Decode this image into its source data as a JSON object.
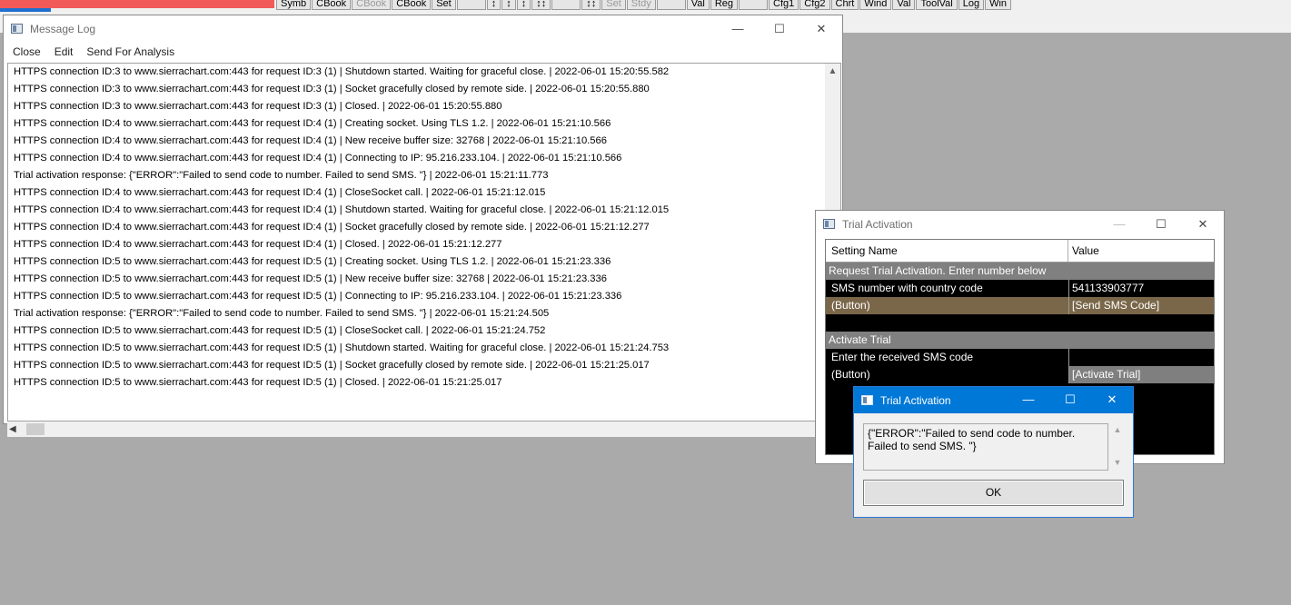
{
  "toolbar": {
    "buttons": [
      "Symb",
      "CBook",
      "CBook",
      "CBook",
      "Set",
      "",
      "↕",
      "↕",
      "↕",
      "↕↕",
      "",
      "↕↕",
      "Set",
      "Stdy",
      "",
      "Val",
      "Reg",
      "",
      "Cfg1",
      "Cfg2",
      "Chrt",
      "Wind",
      "Val",
      "ToolVal",
      "Log",
      "Win"
    ]
  },
  "message_log": {
    "title": "Message Log",
    "menu": [
      "Close",
      "Edit",
      "Send For Analysis"
    ],
    "lines": [
      "HTTPS connection ID:3 to www.sierrachart.com:443 for request ID:3 (1) | Shutdown started.  Waiting for graceful close. | 2022-06-01  15:20:55.582",
      "HTTPS connection ID:3 to www.sierrachart.com:443 for request ID:3 (1) | Socket gracefully closed by remote side. | 2022-06-01  15:20:55.880",
      "HTTPS connection ID:3 to www.sierrachart.com:443 for request ID:3 (1) | Closed. | 2022-06-01  15:20:55.880",
      "HTTPS connection ID:4 to www.sierrachart.com:443 for request ID:4 (1) | Creating socket.  Using TLS 1.2. | 2022-06-01  15:21:10.566",
      "HTTPS connection ID:4 to www.sierrachart.com:443 for request ID:4 (1) | New receive buffer size: 32768 | 2022-06-01  15:21:10.566",
      "HTTPS connection ID:4 to www.sierrachart.com:443 for request ID:4 (1) | Connecting to IP: 95.216.233.104. | 2022-06-01  15:21:10.566",
      "Trial activation response: {\"ERROR\":\"Failed to send code to number.  Failed to send SMS. \"} | 2022-06-01  15:21:11.773",
      "HTTPS connection ID:4 to www.sierrachart.com:443 for request ID:4 (1) | CloseSocket call. | 2022-06-01  15:21:12.015",
      "HTTPS connection ID:4 to www.sierrachart.com:443 for request ID:4 (1) | Shutdown started.  Waiting for graceful close. | 2022-06-01  15:21:12.015",
      "HTTPS connection ID:4 to www.sierrachart.com:443 for request ID:4 (1) | Socket gracefully closed by remote side. | 2022-06-01  15:21:12.277",
      "HTTPS connection ID:4 to www.sierrachart.com:443 for request ID:4 (1) | Closed. | 2022-06-01  15:21:12.277",
      "HTTPS connection ID:5 to www.sierrachart.com:443 for request ID:5 (1) | Creating socket.  Using TLS 1.2. | 2022-06-01  15:21:23.336",
      "HTTPS connection ID:5 to www.sierrachart.com:443 for request ID:5 (1) | New receive buffer size: 32768 | 2022-06-01  15:21:23.336",
      "HTTPS connection ID:5 to www.sierrachart.com:443 for request ID:5 (1) | Connecting to IP: 95.216.233.104. | 2022-06-01  15:21:23.336",
      "Trial activation response: {\"ERROR\":\"Failed to send code to number.  Failed to send SMS. \"} | 2022-06-01  15:21:24.505",
      "HTTPS connection ID:5 to www.sierrachart.com:443 for request ID:5 (1) | CloseSocket call. | 2022-06-01  15:21:24.752",
      "HTTPS connection ID:5 to www.sierrachart.com:443 for request ID:5 (1) | Shutdown started.  Waiting for graceful close. | 2022-06-01  15:21:24.753",
      "HTTPS connection ID:5 to www.sierrachart.com:443 for request ID:5 (1) | Socket gracefully closed by remote side. | 2022-06-01  15:21:25.017",
      "HTTPS connection ID:5 to www.sierrachart.com:443 for request ID:5 (1) | Closed. | 2022-06-01  15:21:25.017"
    ]
  },
  "trial_settings": {
    "title": "Trial Activation",
    "col_setting": "Setting Name",
    "col_value": "Value",
    "section1": "Request Trial Activation. Enter number below",
    "sms_label": "SMS number with country code",
    "sms_value": "541133903777",
    "button1_label": " (Button)",
    "button1_value": "[Send SMS Code]",
    "section2": "Activate Trial",
    "code_label": "Enter the received SMS code",
    "code_value": "",
    "button2_label": " (Button)",
    "button2_value": "[Activate Trial]"
  },
  "error_dialog": {
    "title": "Trial Activation",
    "message": "{\"ERROR\":\"Failed to send code to number.  Failed to send SMS. \"}",
    "ok_label": "OK"
  },
  "icons": {
    "minimize": "—",
    "maximize": "☐",
    "close": "✕",
    "scroll_up": "▲",
    "scroll_down": "▼",
    "scroll_left": "◀"
  }
}
